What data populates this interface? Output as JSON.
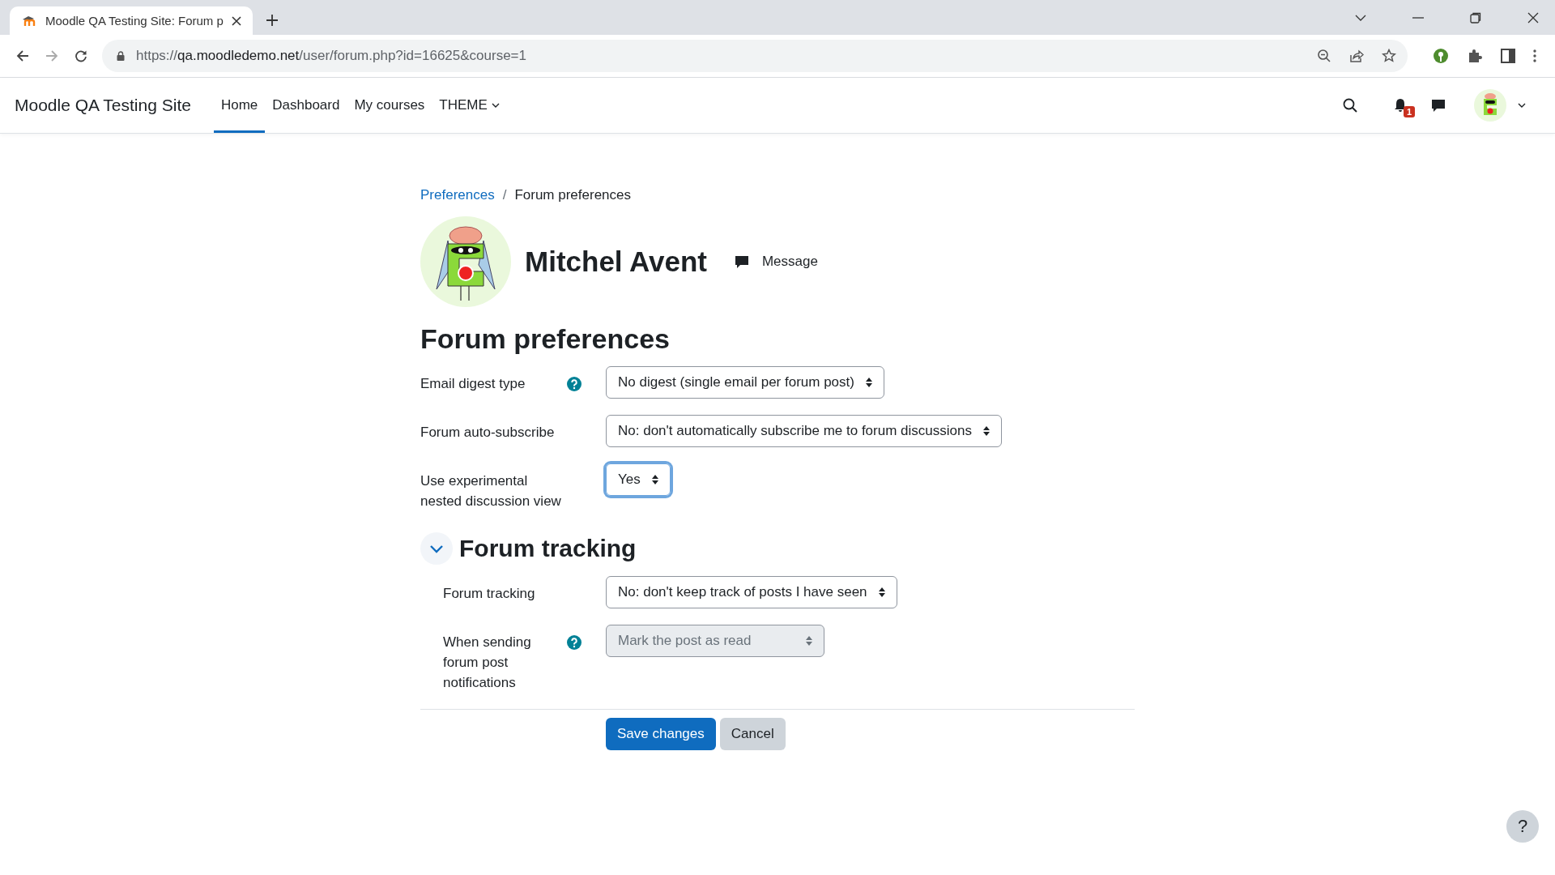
{
  "browser": {
    "tab": {
      "title": "Moodle QA Testing Site: Forum p"
    },
    "address": {
      "scheme": "https://",
      "host": "qa.moodledemo.net",
      "path": "/user/forum.php?id=16625&course=1"
    }
  },
  "navbar": {
    "site_name": "Moodle QA Testing Site",
    "items": [
      {
        "label": "Home",
        "selected": true,
        "dropdown": false
      },
      {
        "label": "Dashboard",
        "selected": false,
        "dropdown": false
      },
      {
        "label": "My courses",
        "selected": false,
        "dropdown": false
      },
      {
        "label": "THEME",
        "selected": false,
        "dropdown": true
      }
    ],
    "notification_count": "1"
  },
  "breadcrumb_separator": "/",
  "breadcrumb": [
    {
      "label": "Preferences",
      "kind": "link"
    },
    {
      "label": "Forum preferences",
      "kind": "current"
    }
  ],
  "profile": {
    "name": "Mitchel Avent",
    "message_label": "Message"
  },
  "heading": "Forum preferences",
  "fields": [
    {
      "label": "Email digest type",
      "help": true,
      "value": "No digest (single email per forum post)",
      "focused": false,
      "disabled": false
    },
    {
      "label": "Forum auto-subscribe",
      "help": false,
      "value": "No: don't automatically subscribe me to forum discussions",
      "focused": false,
      "disabled": false
    },
    {
      "label": "Use experimental nested discussion view",
      "help": false,
      "value": "Yes",
      "focused": true,
      "disabled": false
    }
  ],
  "section": {
    "title": "Forum tracking",
    "expanded": true,
    "fields": [
      {
        "label": "Forum tracking",
        "help": false,
        "value": "No: don't keep track of posts I have seen",
        "focused": false,
        "disabled": false
      },
      {
        "label": "When sending forum post notifications",
        "help": true,
        "value": "Mark the post as read",
        "focused": false,
        "disabled": true
      }
    ]
  },
  "buttons": [
    {
      "label": "Save changes",
      "kind": "primary"
    },
    {
      "label": "Cancel",
      "kind": "secondary"
    }
  ],
  "help_button": "?"
}
